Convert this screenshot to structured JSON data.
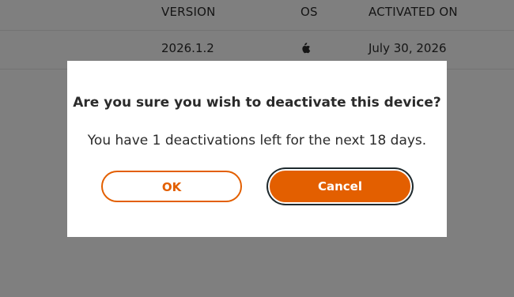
{
  "table": {
    "headers": {
      "version": "VERSION",
      "os": "OS",
      "activated_on": "ACTIVATED ON"
    },
    "rows": [
      {
        "version": "2026.1.2",
        "os_icon": "apple-icon",
        "activated_on": "July 30, 2026"
      }
    ]
  },
  "dialog": {
    "title": "Are you sure you wish to deactivate this device?",
    "message": "You have 1 deactivations left for the next 18 days.",
    "ok_label": "OK",
    "cancel_label": "Cancel"
  },
  "colors": {
    "accent": "#e35f00",
    "overlay": "rgba(0,0,0,0.5)",
    "focus_ring": "#1f2a2e"
  }
}
